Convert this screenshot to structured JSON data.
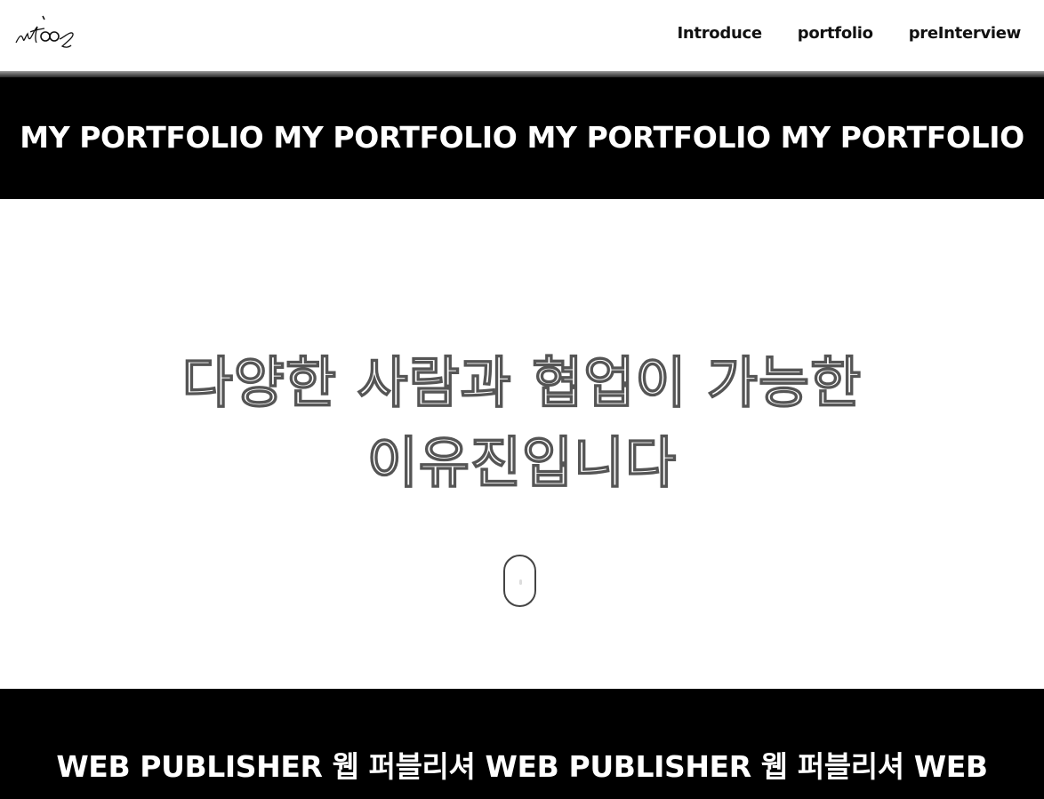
{
  "header": {
    "logo_alt": "signature-logo",
    "nav": [
      {
        "label": "Introduce"
      },
      {
        "label": "portfolio"
      },
      {
        "label": "preInterview"
      }
    ]
  },
  "top_band": {
    "text": "MY PORTFOLIO MY PORTFOLIO MY PORTFOLIO MY PORTFOLIO"
  },
  "hero": {
    "line1": "다양한 사람과 협업이 가능한",
    "line2": "이유진입니다"
  },
  "bottom_band": {
    "text": "WEB PUBLISHER 웹 퍼블리셔 WEB PUBLISHER 웹 퍼블리셔 WEB"
  },
  "icons": {
    "logo": "signature-logo-icon",
    "scroll": "mouse-scroll-icon"
  },
  "colors": {
    "band_background": "#000000",
    "band_text": "#ffffff",
    "page_background": "#ffffff",
    "outline_stroke": "#555555"
  }
}
